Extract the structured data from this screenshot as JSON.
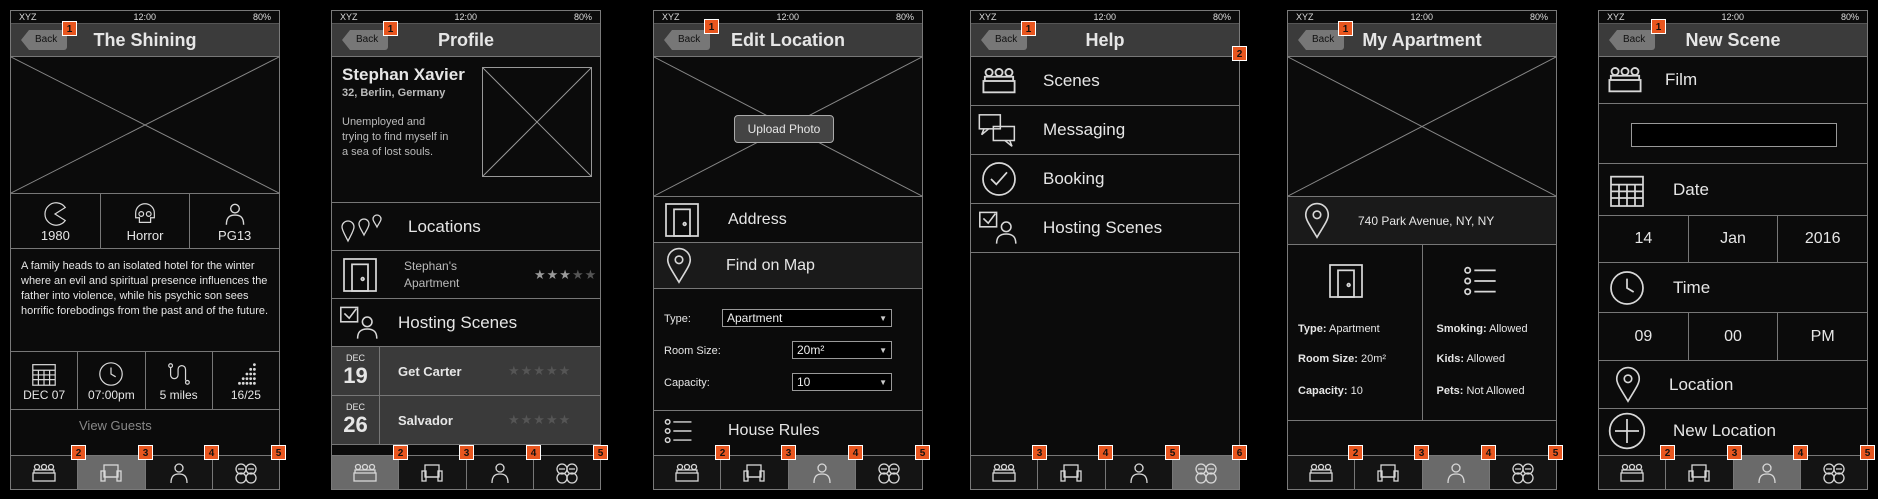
{
  "status": {
    "carrier": "XYZ",
    "time": "12:00",
    "battery": "80%"
  },
  "back_label": "Back",
  "badges": [
    "1",
    "2",
    "3",
    "4",
    "5",
    "6"
  ],
  "screen1": {
    "title": "The Shining",
    "facts": [
      {
        "label": "1980"
      },
      {
        "label": "Horror"
      },
      {
        "label": "PG13"
      }
    ],
    "description": "A family heads to an isolated hotel for the winter where an evil and spiritual presence influences the father into violence, while his psychic son sees horrific forebodings from the past and of the future.",
    "info": [
      {
        "label": "DEC 07"
      },
      {
        "label": "07:00pm"
      },
      {
        "label": "5 miles"
      },
      {
        "label": "16/25"
      }
    ],
    "view_guests": "View Guests"
  },
  "screen2": {
    "title": "Profile",
    "name": "Stephan Xavier",
    "meta": "32, Berlin, Germany",
    "bio": "Unemployed and trying to find myself in a sea of lost souls.",
    "locations_label": "Locations",
    "apartment": "Stephan's Apartment",
    "apartment_rating": 3,
    "hosting_label": "Hosting Scenes",
    "events": [
      {
        "month": "DEC",
        "day": "19",
        "title": "Get Carter",
        "rating": 0
      },
      {
        "month": "DEC",
        "day": "26",
        "title": "Salvador",
        "rating": 0
      }
    ]
  },
  "screen3": {
    "title": "Edit Location",
    "upload": "Upload Photo",
    "address": "Address",
    "find_map": "Find on Map",
    "type_label": "Type:",
    "type_value": "Apartment",
    "size_label": "Room Size:",
    "size_value": "20m²",
    "capacity_label": "Capacity:",
    "capacity_value": "10",
    "rules": "House Rules"
  },
  "screen4": {
    "title": "Help",
    "items": [
      {
        "label": "Scenes"
      },
      {
        "label": "Messaging"
      },
      {
        "label": "Booking"
      },
      {
        "label": "Hosting Scenes"
      }
    ]
  },
  "screen5": {
    "title": "My Apartment",
    "address": "740 Park Avenue, NY, NY",
    "left": [
      {
        "k": "Type:",
        "v": "Apartment"
      },
      {
        "k": "Room Size:",
        "v": "20m²"
      },
      {
        "k": "Capacity:",
        "v": "10"
      }
    ],
    "right": [
      {
        "k": "Smoking:",
        "v": "Allowed"
      },
      {
        "k": "Kids:",
        "v": "Allowed"
      },
      {
        "k": "Pets:",
        "v": "Not Allowed"
      }
    ]
  },
  "screen6": {
    "title": "New Scene",
    "film": "Film",
    "date": "Date",
    "date_day": "14",
    "date_month": "Jan",
    "date_year": "2016",
    "time": "Time",
    "time_h": "09",
    "time_m": "00",
    "time_ampm": "PM",
    "location": "Location",
    "new_location": "New Location"
  },
  "icons": {
    "tab1": "theater-seats-icon",
    "tab2": "armchair-icon",
    "tab3": "person-icon",
    "tab4": "film-reels-icon"
  }
}
